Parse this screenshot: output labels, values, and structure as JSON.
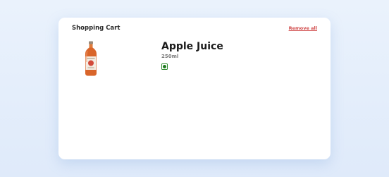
{
  "cart": {
    "title": "Shopping Cart",
    "remove_all_label": "Remove all",
    "items": [
      {
        "name": "Apple Juice",
        "volume": "250ml",
        "image_icon": "juice-bottle-icon",
        "badge_icon": "veg-indicator-icon"
      }
    ]
  },
  "colors": {
    "remove_all": "#d14b4b",
    "veg_badge": "#2e8b2e",
    "juice": "#d9652a"
  }
}
